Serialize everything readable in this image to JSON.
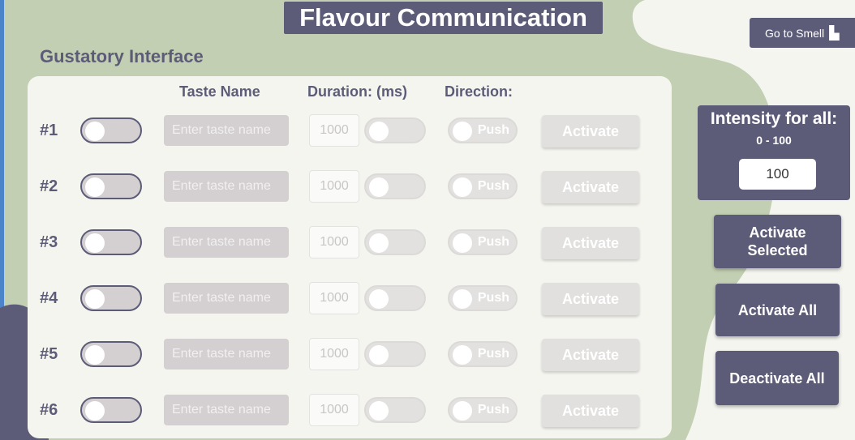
{
  "header": {
    "title": "Flavour Communication"
  },
  "nav": {
    "goto_smell_label": "Go to Smell"
  },
  "section": {
    "title": "Gustatory Interface"
  },
  "columns": {
    "taste_name": "Taste Name",
    "duration": "Duration: (ms)",
    "direction": "Direction:"
  },
  "rows": [
    {
      "label": "#1",
      "taste_placeholder": "Enter taste name",
      "duration_value": "1000",
      "direction_label": "Push",
      "activate_label": "Activate"
    },
    {
      "label": "#2",
      "taste_placeholder": "Enter taste name",
      "duration_value": "1000",
      "direction_label": "Push",
      "activate_label": "Activate"
    },
    {
      "label": "#3",
      "taste_placeholder": "Enter taste name",
      "duration_value": "1000",
      "direction_label": "Push",
      "activate_label": "Activate"
    },
    {
      "label": "#4",
      "taste_placeholder": "Enter taste name",
      "duration_value": "1000",
      "direction_label": "Push",
      "activate_label": "Activate"
    },
    {
      "label": "#5",
      "taste_placeholder": "Enter taste name",
      "duration_value": "1000",
      "direction_label": "Push",
      "activate_label": "Activate"
    },
    {
      "label": "#6",
      "taste_placeholder": "Enter taste name",
      "duration_value": "1000",
      "direction_label": "Push",
      "activate_label": "Activate"
    }
  ],
  "intensity": {
    "title": "Intensity for all:",
    "range": "0 - 100",
    "value": "100"
  },
  "actions": {
    "activate_selected_line1": "Activate",
    "activate_selected_line2": "Selected",
    "activate_all": "Activate All",
    "deactivate_all": "Deactivate All"
  },
  "icons": {
    "goto_icon": "door-icon"
  },
  "colors": {
    "accent": "#5d5c78",
    "background": "#c3cfb2",
    "panel": "#f5f5f0"
  }
}
